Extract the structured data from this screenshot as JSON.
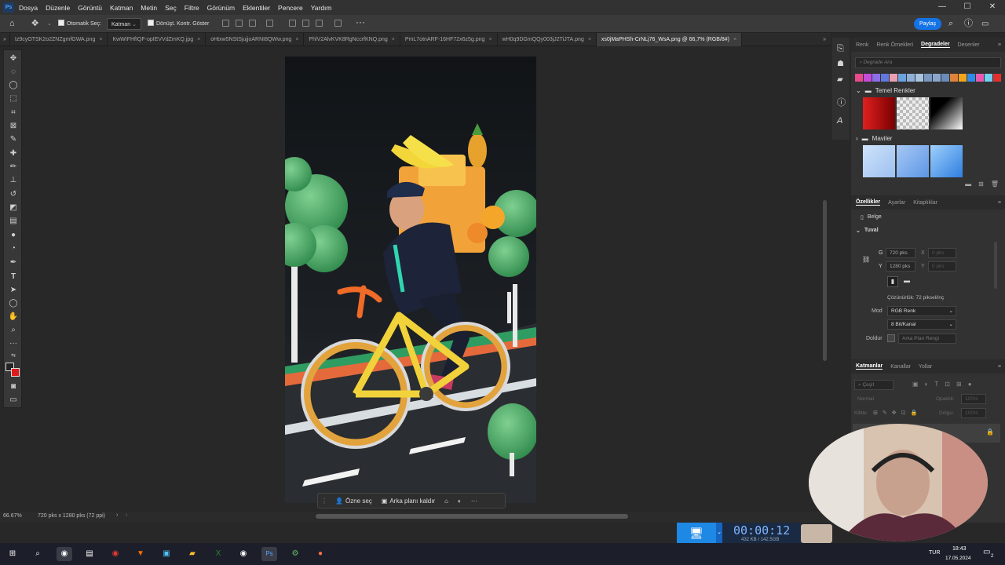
{
  "menubar": {
    "app_icon": "Ps",
    "items": [
      "Dosya",
      "Düzenle",
      "Görüntü",
      "Katman",
      "Metin",
      "Seç",
      "Filtre",
      "Görünüm",
      "Eklentiler",
      "Pencere",
      "Yardım"
    ],
    "window_controls": [
      "—",
      "☐",
      "✕"
    ]
  },
  "options": {
    "auto_select": "Otomatik Seç:",
    "auto_select_value": "Katman",
    "transform_controls": "Dönüşt. Kontr. Göster",
    "share": "Paylaş"
  },
  "tabs": [
    {
      "label": "Iz9cyOTSK2o2ZNZgmfGWA.png",
      "active": false
    },
    {
      "label": "KwWIFHfIQF-opIEVVdZmKQ.jpg",
      "active": false
    },
    {
      "label": "oHtxw5NStSjujjoARNI8QWw.png",
      "active": false
    },
    {
      "label": "PhlV2AlvKVK8RgNccrfKNQ.png",
      "active": false
    },
    {
      "label": "PmL7otnARF-16HF72x6z5g.png",
      "active": false
    },
    {
      "label": "wH0q9DGmQQy003jJ2TiJTA.png",
      "active": false
    },
    {
      "label": "xs0jMaPHSh-CrNLj76_WsA.png @ 66,7% (RGB/8#)",
      "active": true
    }
  ],
  "context_bar": {
    "select_subject": "Özne seç",
    "remove_bg": "Arka planı kaldır"
  },
  "status": {
    "zoom": "66.67%",
    "doc_size": "720 pks x 1280 pks (72 ppi)"
  },
  "right_panel": {
    "top_tabs": [
      "Renk",
      "Renk Örnekleri",
      "Degradeler",
      "Desenler"
    ],
    "active_top_tab": "Degradeler",
    "gradient_search": "Degrade Ara",
    "swatch_colors": [
      "#e84a8a",
      "#c44cd8",
      "#8e6ee8",
      "#5f79e0",
      "#e8a0b0",
      "#6aa3e0",
      "#8fb0d6",
      "#a8c4de",
      "#7b98c2",
      "#8aa6cc",
      "#6b8bb8",
      "#e0823a",
      "#f2a41b",
      "#2c8ce8",
      "#e85ab0",
      "#6fd0f0",
      "#e03030"
    ],
    "group1": "Temel Renkler",
    "group2": "Maviler",
    "props_tabs": [
      "Özellikler",
      "Ayarlar",
      "Kitaplıklar"
    ],
    "active_props_tab": "Özellikler",
    "doc_label": "Belge",
    "canvas_section": "Tuval",
    "w_label": "G",
    "w_value": "720 pks",
    "h_label": "Y",
    "h_value": "1280 pks",
    "x_label": "X",
    "x_value": "0 pks",
    "y_label": "Y",
    "y_value": "0 pks",
    "resolution": "Çözünürlük: 72 piksel/inç",
    "mode_label": "Mod",
    "mode_value": "RGB Renk",
    "depth_value": "8 Bit/Kanal",
    "fill_label": "Doldur",
    "fill_value": "Arka Plan Rengi",
    "layer_tabs": [
      "Katmanlar",
      "Kanallar",
      "Yollar"
    ],
    "active_layer_tab": "Katmanlar",
    "kind_filter": "Çeşit",
    "blend_mode": "Normal",
    "opacity_label": "Opaklık:",
    "opacity_value": "100%",
    "lock_label": "Kilitle:",
    "fill2_label": "Dolgu:",
    "fill2_value": "100%"
  },
  "recorder": {
    "time": "00:00:12",
    "size": "432 KB / 142.5GB"
  },
  "taskbar": {
    "lang": "TUR",
    "time": "18:43",
    "date": "17.05.2024",
    "notif": "2"
  }
}
